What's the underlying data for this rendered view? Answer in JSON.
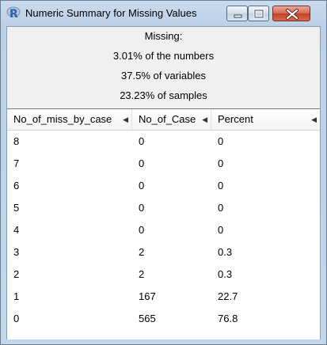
{
  "window": {
    "title": "Numeric Summary for Missing Values",
    "icon": "r-logo-icon",
    "controls": [
      "minimize-icon",
      "maximize-icon",
      "close-icon"
    ],
    "close_color": "#c1402a"
  },
  "summary": {
    "heading": "Missing:",
    "numbers": "3.01% of the numbers",
    "variables": "37.5% of variables",
    "samples": "23.23% of samples"
  },
  "table": {
    "columns": [
      "No_of_miss_by_case",
      "No_of_Case",
      "Percent"
    ],
    "rows": [
      [
        "8",
        "0",
        "0"
      ],
      [
        "7",
        "0",
        "0"
      ],
      [
        "6",
        "0",
        "0"
      ],
      [
        "5",
        "0",
        "0"
      ],
      [
        "4",
        "0",
        "0"
      ],
      [
        "3",
        "2",
        "0.3"
      ],
      [
        "2",
        "2",
        "0.3"
      ],
      [
        "1",
        "167",
        "22.7"
      ],
      [
        "0",
        "565",
        "76.8"
      ]
    ]
  }
}
